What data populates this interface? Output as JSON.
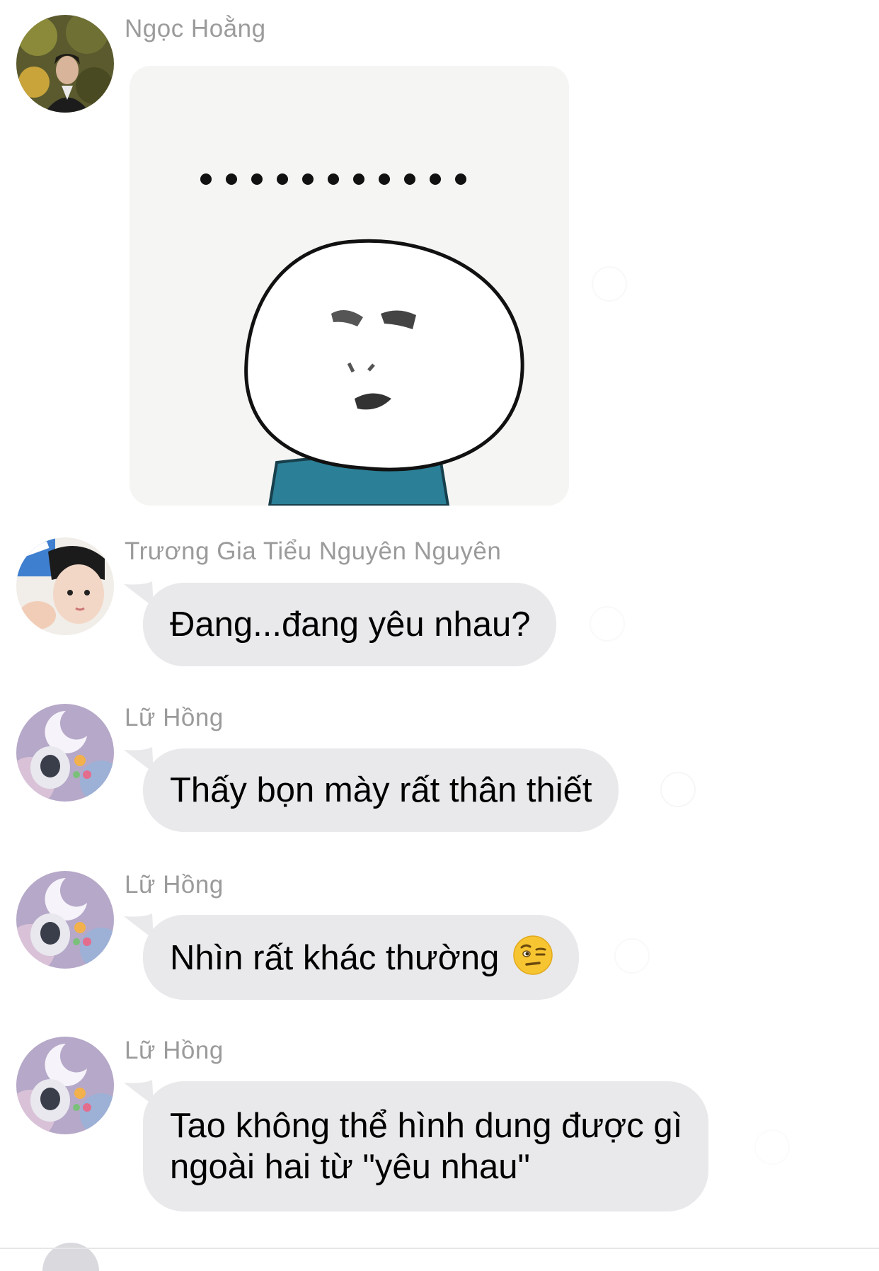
{
  "messages": [
    {
      "sender": "Ngọc Hoằng",
      "type": "sticker",
      "sticker_icon": "annoyed-face-sticker"
    },
    {
      "sender": "Trương Gia Tiểu Nguyên Nguyên",
      "type": "text",
      "text": "Đang...đang yêu nhau?"
    },
    {
      "sender": "Lữ Hồng",
      "type": "text",
      "text": "Thấy bọn mày rất thân thiết"
    },
    {
      "sender": "Lữ Hồng",
      "type": "text",
      "text": "Nhìn rất khác thường",
      "emoji": "face-with-raised-eyebrow-emoji"
    },
    {
      "sender": "Lữ Hồng",
      "type": "text",
      "lines": [
        "Tao không thể hình dung được gì",
        "ngoài hai từ \"yêu nhau\""
      ]
    }
  ],
  "colors": {
    "bubble": "#e9e9eb",
    "sender_name": "#9b9b9b",
    "text": "#000000",
    "sticker_shirt": "#2b7f96"
  }
}
